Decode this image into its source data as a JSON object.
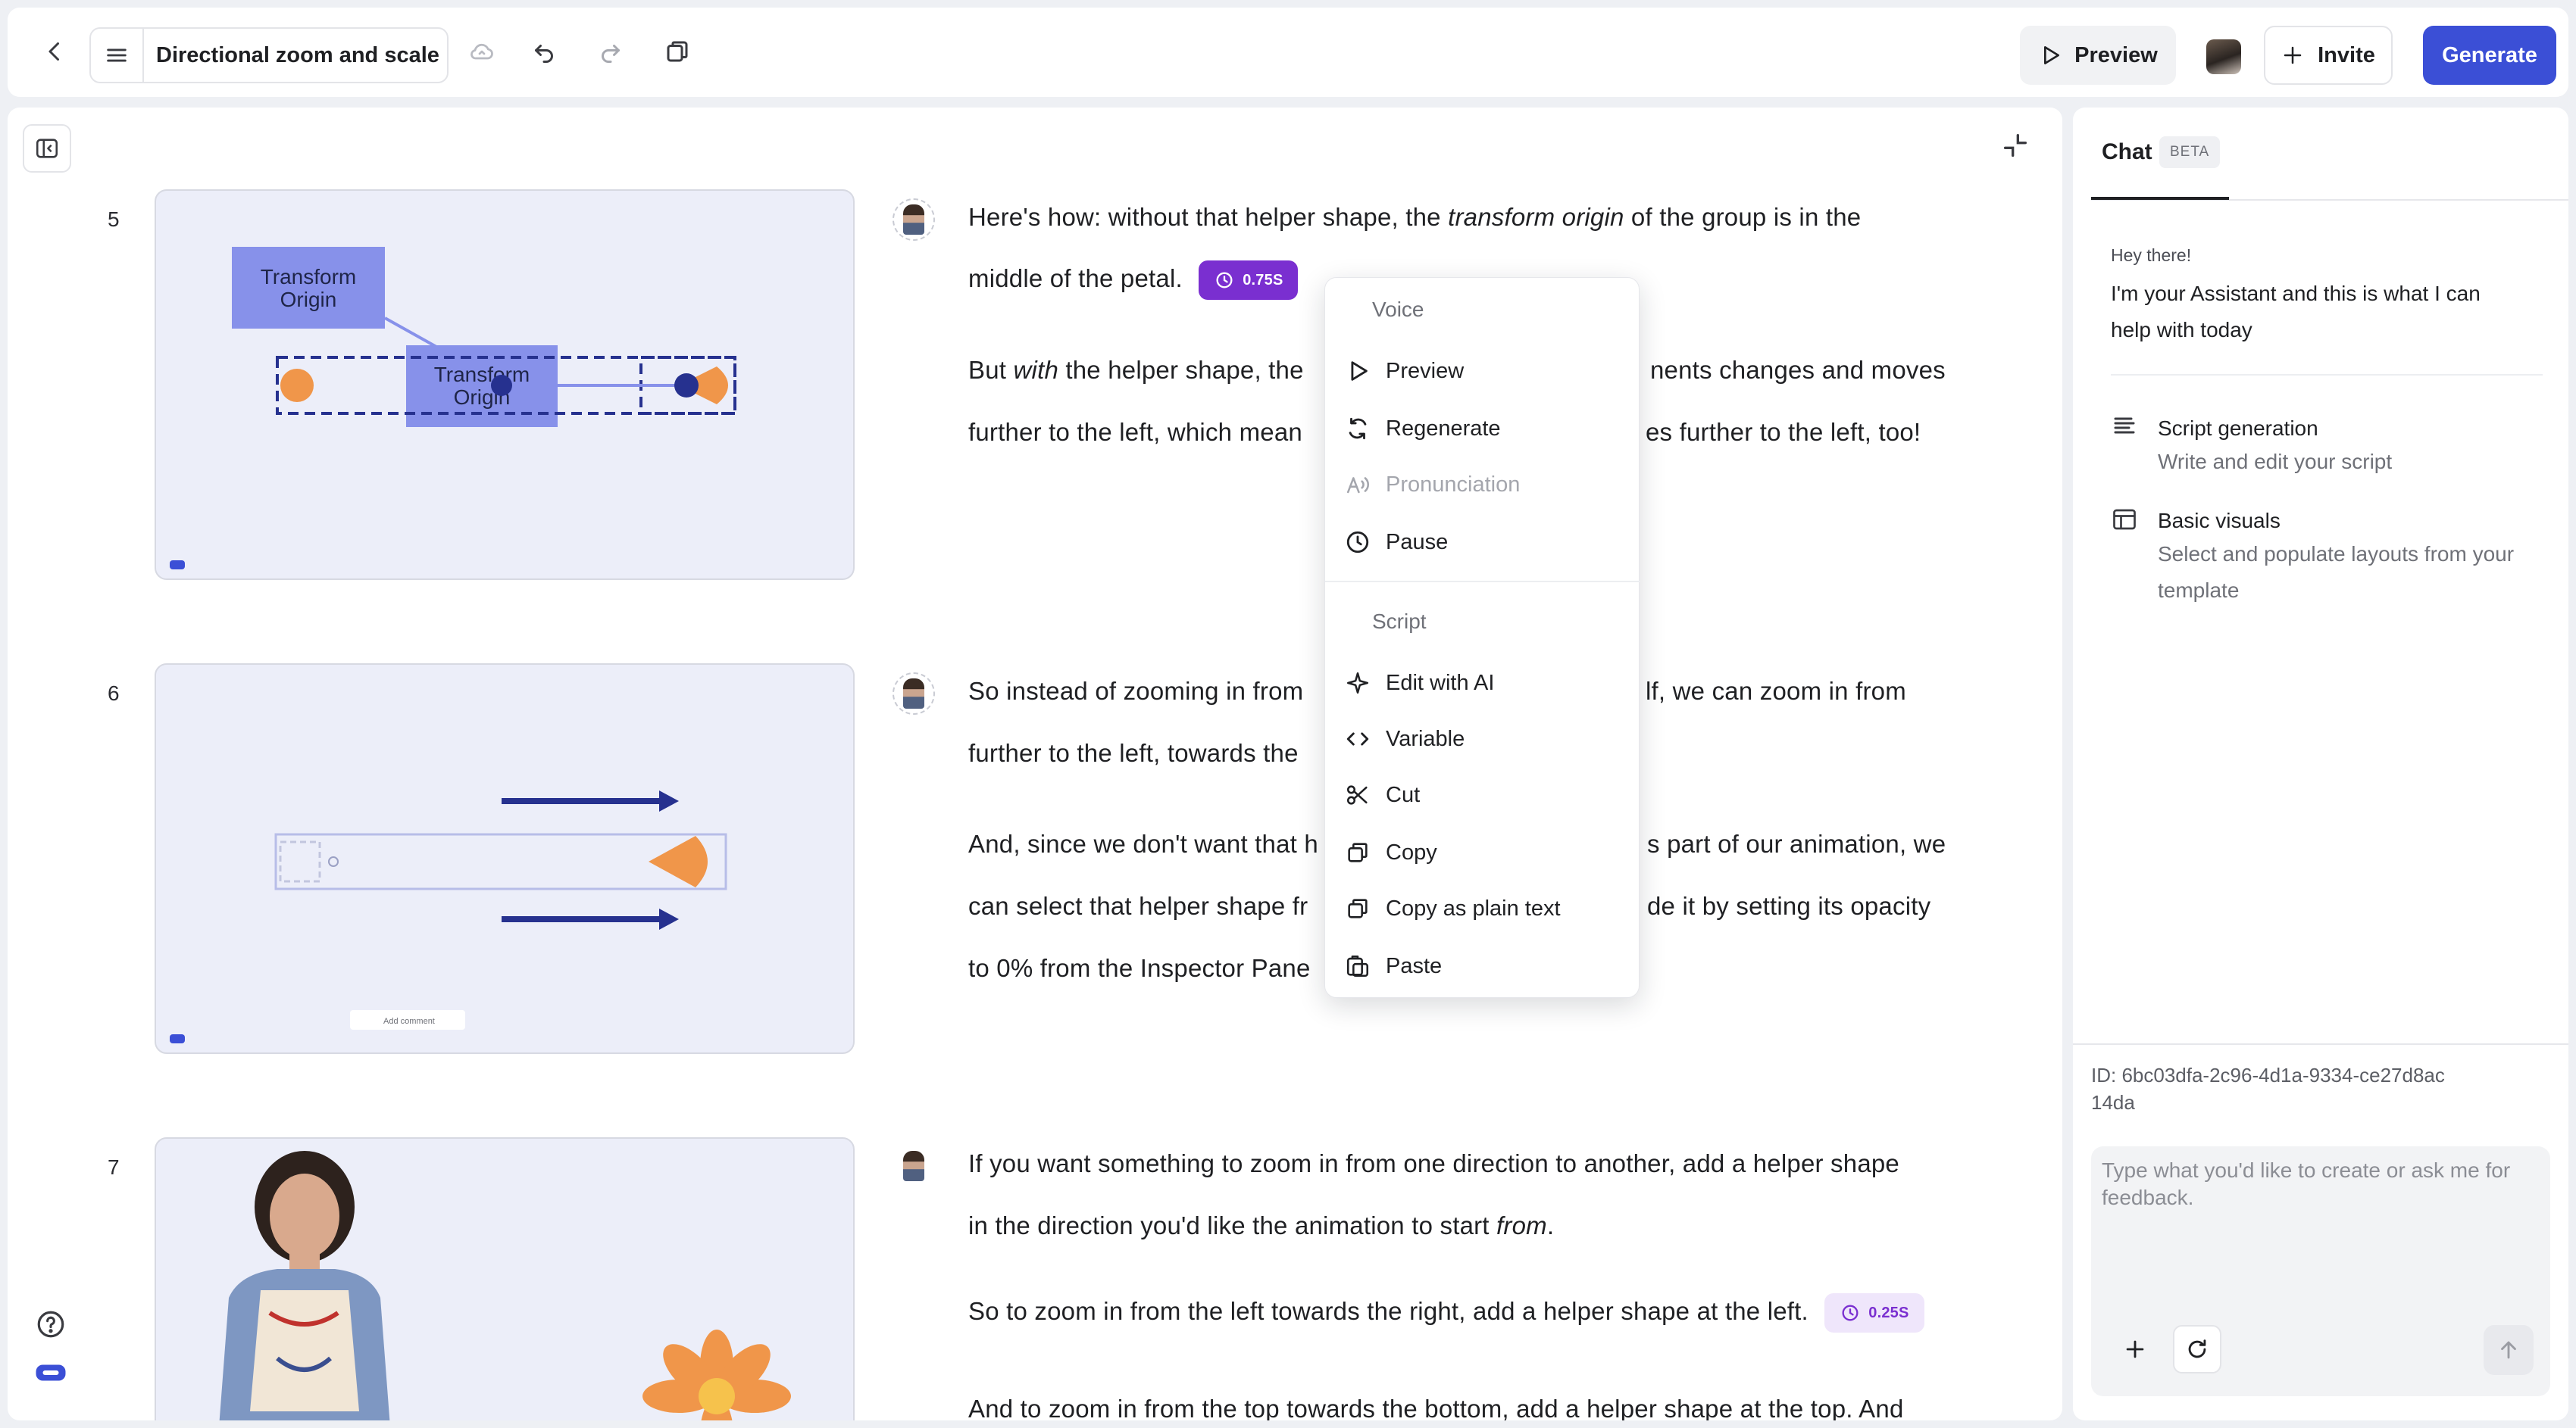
{
  "topbar": {
    "title": "Directional zoom and scale",
    "preview_label": "Preview",
    "invite_label": "Invite",
    "generate_label": "Generate"
  },
  "scenes": [
    {
      "number": "5",
      "thumb": {
        "box_left": "Transform\nOrigin",
        "box_mid": "Transform\nOrigin",
        "logo": "community"
      },
      "lines": [
        {
          "pre": "Here's how: without that helper shape, the ",
          "em": "transform origin",
          "post": " of the group is in the"
        },
        {
          "text": "middle of the petal.",
          "pill": "0.75S"
        },
        {
          "pre": "But ",
          "em": "with",
          "post": " the helper shape, the",
          "tail": "nents changes and moves"
        },
        {
          "text": "further to the left, which mean",
          "tail": "es further to the left, too!"
        }
      ]
    },
    {
      "number": "6",
      "thumb": {
        "add_comment": "Add comment",
        "logo": "community"
      },
      "lines": [
        {
          "text": "So instead of zooming in from",
          "tail": "lf, we can zoom in from"
        },
        {
          "text": "further to the left, towards the"
        },
        {
          "text": "And, since we don't want that h",
          "tail": "s part of our animation, we"
        },
        {
          "text": "can select that helper shape fr",
          "tail": "de it by setting its opacity"
        },
        {
          "text": "to 0% from the Inspector Pane"
        }
      ]
    },
    {
      "number": "7",
      "lines": [
        {
          "text": "If you want something to zoom in from one direction to another, add a helper shape"
        },
        {
          "pre": "in the direction you'd like the animation to start ",
          "em": "from",
          "post": "."
        },
        {
          "text": "So to zoom in from the left towards the right, add a helper shape at the left.",
          "pill": "0.25S"
        },
        {
          "text": "And to zoom in from the top towards the bottom, add a helper shape at the top. And"
        }
      ]
    }
  ],
  "context_menu": {
    "voice_header": "Voice",
    "voice_items": [
      {
        "label": "Preview",
        "icon": "play-icon"
      },
      {
        "label": "Regenerate",
        "icon": "regenerate-icon"
      },
      {
        "label": "Pronunciation",
        "icon": "pronunciation-icon",
        "disabled": true
      },
      {
        "label": "Pause",
        "icon": "clock-icon"
      }
    ],
    "script_header": "Script",
    "script_items": [
      {
        "label": "Edit with AI",
        "icon": "sparkle-icon"
      },
      {
        "label": "Variable",
        "icon": "code-icon"
      },
      {
        "label": "Cut",
        "icon": "scissors-icon"
      },
      {
        "label": "Copy",
        "icon": "copy-icon"
      },
      {
        "label": "Copy as plain text",
        "icon": "copy-icon"
      },
      {
        "label": "Paste",
        "icon": "paste-icon"
      }
    ]
  },
  "chat": {
    "tab_label": "Chat",
    "beta_label": "BETA",
    "greeting": "Hey there!",
    "intro": "I'm your Assistant and this is what I can help with today",
    "features": [
      {
        "title": "Script generation",
        "description": "Write and edit your script",
        "icon": "lines-icon"
      },
      {
        "title": "Basic visuals",
        "description": "Select and populate layouts from your template",
        "icon": "layout-icon"
      }
    ],
    "id_text": "ID: 6bc03dfa-2c96-4d1a-9334-ce27d8ac14da",
    "input_placeholder": "Type what you'd like to create or ask me for feedback."
  },
  "colors": {
    "accent": "#3b4fd6",
    "pill_purple": "#7a2fd0",
    "thumb_bg": "#eceef9",
    "orange": "#f0964a",
    "navy": "#26318f"
  }
}
